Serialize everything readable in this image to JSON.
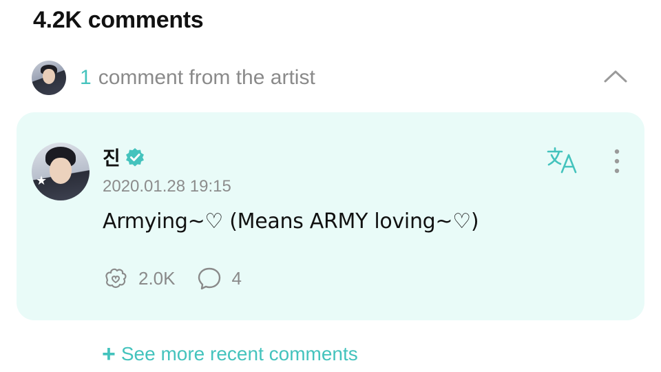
{
  "header": {
    "title": "4.2K comments"
  },
  "artist_section": {
    "count": "1",
    "label": "comment from the artist",
    "toggle_icon": "chevron-up-icon"
  },
  "comment": {
    "author": "진",
    "verified_icon": "verified-badge-icon",
    "timestamp": "2020.01.28 19:15",
    "text": "Armying~♡ (Means ARMY loving~♡)",
    "likes": "2.0K",
    "replies": "4",
    "translate_icon": "translate-icon",
    "more_icon": "more-vertical-icon"
  },
  "footer": {
    "plus": "+",
    "see_more": "See more recent comments"
  },
  "colors": {
    "accent": "#44c3bd",
    "card_bg": "#e9fbf8",
    "muted": "#8a8a8a"
  }
}
